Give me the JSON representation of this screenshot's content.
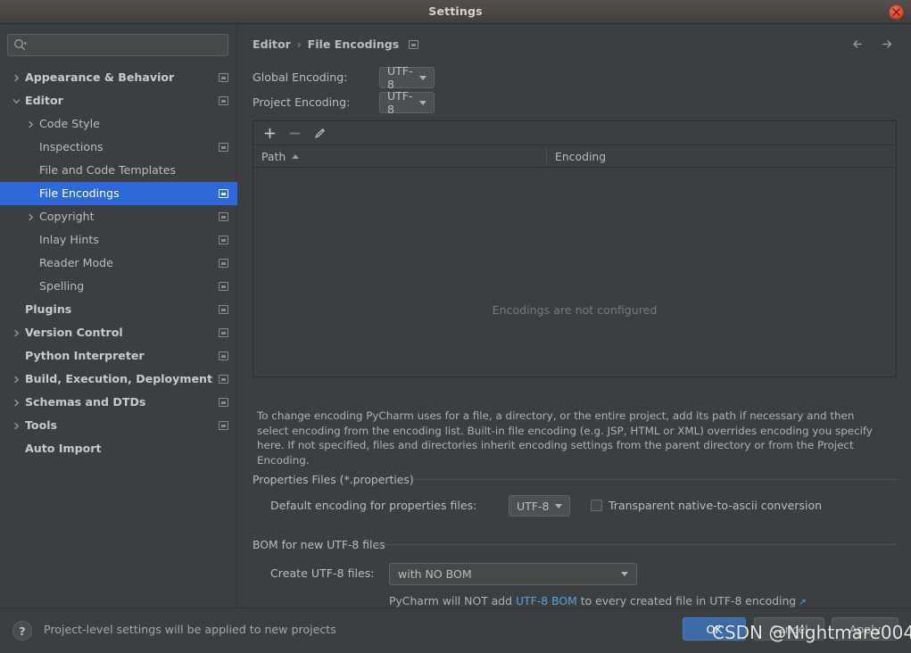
{
  "window": {
    "title": "Settings",
    "close_icon": "close-icon"
  },
  "sidebar": {
    "search": {
      "placeholder": "",
      "value": "",
      "icon": "search-icon"
    },
    "items": [
      {
        "label": "Appearance & Behavior",
        "arrow": "chevron-right",
        "bold": true,
        "indent": 28,
        "config": true,
        "selected": false
      },
      {
        "label": "Editor",
        "arrow": "chevron-down",
        "bold": true,
        "indent": 28,
        "config": true,
        "selected": false
      },
      {
        "label": "Code Style",
        "arrow": "chevron-right",
        "bold": false,
        "indent": 44,
        "config": false,
        "selected": false
      },
      {
        "label": "Inspections",
        "arrow": "",
        "bold": false,
        "indent": 44,
        "config": true,
        "selected": false
      },
      {
        "label": "File and Code Templates",
        "arrow": "",
        "bold": false,
        "indent": 44,
        "config": false,
        "selected": false
      },
      {
        "label": "File Encodings",
        "arrow": "",
        "bold": false,
        "indent": 44,
        "config": true,
        "selected": true
      },
      {
        "label": "Copyright",
        "arrow": "chevron-right",
        "bold": false,
        "indent": 44,
        "config": true,
        "selected": false
      },
      {
        "label": "Inlay Hints",
        "arrow": "",
        "bold": false,
        "indent": 44,
        "config": true,
        "selected": false
      },
      {
        "label": "Reader Mode",
        "arrow": "",
        "bold": false,
        "indent": 44,
        "config": true,
        "selected": false
      },
      {
        "label": "Spelling",
        "arrow": "",
        "bold": false,
        "indent": 44,
        "config": true,
        "selected": false
      },
      {
        "label": "Plugins",
        "arrow": "",
        "bold": true,
        "indent": 28,
        "config": true,
        "selected": false
      },
      {
        "label": "Version Control",
        "arrow": "chevron-right",
        "bold": true,
        "indent": 28,
        "config": true,
        "selected": false
      },
      {
        "label": "Python Interpreter",
        "arrow": "",
        "bold": true,
        "indent": 28,
        "config": true,
        "selected": false
      },
      {
        "label": "Build, Execution, Deployment",
        "arrow": "chevron-right",
        "bold": true,
        "indent": 28,
        "config": true,
        "selected": false
      },
      {
        "label": "Schemas and DTDs",
        "arrow": "chevron-right",
        "bold": true,
        "indent": 28,
        "config": true,
        "selected": false
      },
      {
        "label": "Tools",
        "arrow": "chevron-right",
        "bold": true,
        "indent": 28,
        "config": true,
        "selected": false
      },
      {
        "label": "Auto Import",
        "arrow": "",
        "bold": true,
        "indent": 28,
        "config": false,
        "selected": false
      }
    ]
  },
  "main": {
    "breadcrumb": {
      "root": "Editor",
      "separator": "›",
      "leaf": "File Encodings"
    },
    "nav": {
      "back_icon": "arrow-left-icon",
      "forward_icon": "arrow-right-icon"
    },
    "global_encoding": {
      "label": "Global Encoding:",
      "value": "UTF-8"
    },
    "project_encoding": {
      "label": "Project Encoding:",
      "value": "UTF-8"
    },
    "table": {
      "toolbar": {
        "add": "+",
        "remove": "−",
        "edit": "pencil-icon"
      },
      "columns": [
        "Path",
        "Encoding"
      ],
      "sort_column": "Path",
      "sort_direction": "asc",
      "rows": [],
      "empty_message": "Encodings are not configured"
    },
    "help_text": "To change encoding PyCharm uses for a file, a directory, or the entire project, add its path if necessary and then select encoding from the encoding list. Built-in file encoding (e.g. JSP, HTML or XML) overrides encoding you specify here. If not specified, files and directories inherit encoding settings from the parent directory or from the Project Encoding.",
    "properties_group": {
      "title": "Properties Files (*.properties)",
      "default_encoding_label": "Default encoding for properties files:",
      "default_encoding_value": "UTF-8",
      "transparent_label": "Transparent native-to-ascii conversion",
      "transparent_checked": false
    },
    "bom_group": {
      "title": "BOM for new UTF-8 files",
      "create_label": "Create UTF-8 files:",
      "create_value": "with NO BOM",
      "note_prefix": "PyCharm will NOT add ",
      "note_link": "UTF-8 BOM",
      "note_suffix": " to every created file in UTF-8 encoding",
      "ext_arrow": "↗"
    }
  },
  "footer": {
    "help_icon": "?",
    "note": "Project-level settings will be applied to new projects",
    "ok": "OK",
    "cancel": "Cancel",
    "apply": "Apply"
  },
  "watermark": {
    "text": "CSDN @Nightmare004"
  },
  "colors": {
    "background": "#3c3f41",
    "selection": "#2f68d8",
    "link": "#5c9fe0",
    "primary_button": "#3c6ba5",
    "text": "#bbbbbb",
    "close_button": "#e04a36"
  }
}
